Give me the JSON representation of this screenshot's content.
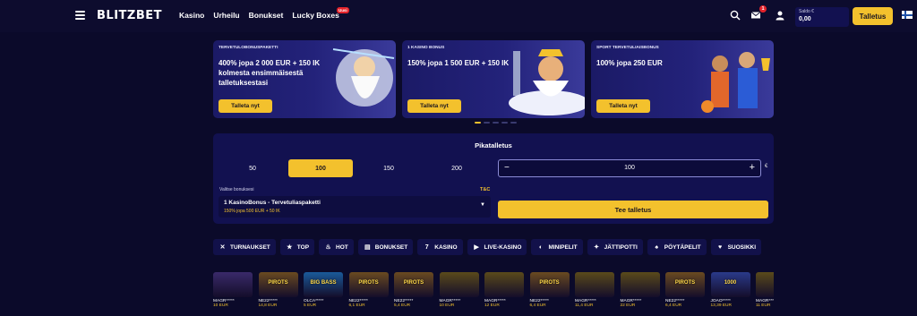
{
  "header": {
    "logo": "BLITZBET",
    "nav": [
      {
        "label": "Kasino"
      },
      {
        "label": "Urheilu"
      },
      {
        "label": "Bonukset"
      },
      {
        "label": "Lucky Boxes",
        "badge": "Uusi"
      }
    ],
    "mail_count": "1",
    "balance_label": "Saldo €",
    "balance_value": "0,00",
    "deposit_label": "Talletus",
    "icons": [
      "menu-icon",
      "search-icon",
      "mail-icon",
      "user-icon",
      "finland-flag-icon"
    ]
  },
  "banners": [
    {
      "tag": "TERVETULOBONUSPAKETTI",
      "title": "400% jopa 2 000 EUR + 150 IK kolmesta ensimmäisestä talletuksestasi",
      "cta": "Talleta nyt"
    },
    {
      "tag": "1 KASINO BONUS",
      "title": "150% jopa 1 500 EUR + 150 IK",
      "cta": "Talleta nyt"
    },
    {
      "tag": "SPORT TERVETULIAISBONUS",
      "title": "100% jopa 250 EUR",
      "cta": "Talleta nyt"
    }
  ],
  "quick_deposit": {
    "title": "Pikatalletus",
    "amounts": [
      "50",
      "100",
      "150",
      "200"
    ],
    "selected_amount": "100",
    "stepper_value": "100",
    "currency": "€",
    "bonus_label": "Valitse bonuksesi",
    "tc_label": "T&C",
    "bonus_name": "1 KasinoBonus - Tervetuliaspaketti",
    "bonus_sub": "150% jopa 500 EUR + 50 IK",
    "submit_label": "Tee talletus"
  },
  "categories": [
    {
      "label": "TURNAUKSET",
      "icon": "trophy-icon"
    },
    {
      "label": "TOP",
      "icon": "star-icon"
    },
    {
      "label": "HOT",
      "icon": "flame-icon"
    },
    {
      "label": "BONUKSET",
      "icon": "ticket-icon"
    },
    {
      "label": "KASINO",
      "icon": "seven-icon"
    },
    {
      "label": "LIVE-KASINO",
      "icon": "video-icon"
    },
    {
      "label": "MINIPELIT",
      "icon": "rocket-icon"
    },
    {
      "label": "JÄTTIPOTTI",
      "icon": "jackpot-icon"
    },
    {
      "label": "PÖYTÄPELIT",
      "icon": "cards-icon"
    },
    {
      "label": "SUOSIKKI",
      "icon": "heart-icon"
    }
  ],
  "wins": [
    {
      "user": "MAGR*****",
      "amount": "10 EUR",
      "thumb": "",
      "color": "#3a2a6a"
    },
    {
      "user": "NE22*****",
      "amount": "14,8 EUR",
      "thumb": "PIROTS",
      "color": "#6a4a20"
    },
    {
      "user": "OLCA*****",
      "amount": "5 EUR",
      "thumb": "BIG BASS",
      "color": "#1a5a9a"
    },
    {
      "user": "NE22*****",
      "amount": "6,1 EUR",
      "thumb": "PIROTS",
      "color": "#6a4a20"
    },
    {
      "user": "NE22*****",
      "amount": "5,4 EUR",
      "thumb": "PIROTS",
      "color": "#6a4a20"
    },
    {
      "user": "MAGR*****",
      "amount": "10 EUR",
      "thumb": "",
      "color": "#5a4a1a"
    },
    {
      "user": "MAGR*****",
      "amount": "12 EUR",
      "thumb": "",
      "color": "#5a4a1a"
    },
    {
      "user": "NE22*****",
      "amount": "6,4 EUR",
      "thumb": "PIROTS",
      "color": "#6a4a20"
    },
    {
      "user": "MAGR*****",
      "amount": "11,4 EUR",
      "thumb": "",
      "color": "#5a4a1a"
    },
    {
      "user": "MAGR*****",
      "amount": "22 EUR",
      "thumb": "",
      "color": "#5a4a1a"
    },
    {
      "user": "NE22*****",
      "amount": "6,4 EUR",
      "thumb": "PIROTS",
      "color": "#6a4a20"
    },
    {
      "user": "JOAO*****",
      "amount": "13,39 EUR",
      "thumb": "1000",
      "color": "#2a3a8a"
    },
    {
      "user": "MAGR*****",
      "amount": "11 EUR",
      "thumb": "",
      "color": "#5a4a1a"
    }
  ],
  "colors": {
    "accent": "#f3c12d",
    "background": "#0b0a2a",
    "panel": "#121150",
    "badge": "#e4232b"
  }
}
